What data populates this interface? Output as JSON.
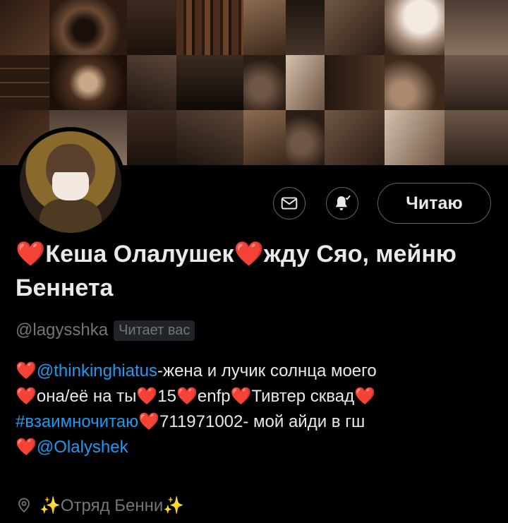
{
  "profile": {
    "heart": "❤️",
    "name_part1": "Кеша Олалушек",
    "name_part2": "жду Сяо, мейню Беннета",
    "handle": "@lagysshka",
    "follows_you_badge": "Читает вас",
    "follow_button_label": "Читаю",
    "location": "✨Отряд Бенни✨"
  },
  "bio": {
    "mention_1": "@thinkinghiatus",
    "text_1": "-жена и лучик солнца моего",
    "text_2": "она/её на ты",
    "text_3": "15",
    "text_4": "enfp",
    "text_5": "Тивтер сквад",
    "hashtag": "#взаимночитаю",
    "text_6": "711971002- мой айди в гш",
    "mention_2": "@Olalyshek"
  },
  "icons": {
    "mail": "mail-icon",
    "bell": "notification-bell-icon",
    "location": "location-pin-icon"
  },
  "colors": {
    "background": "#000000",
    "text_primary": "#e7e9ea",
    "text_secondary": "#71767b",
    "link": "#1d9bf0",
    "heart": "#d0694a",
    "border": "#536471"
  }
}
